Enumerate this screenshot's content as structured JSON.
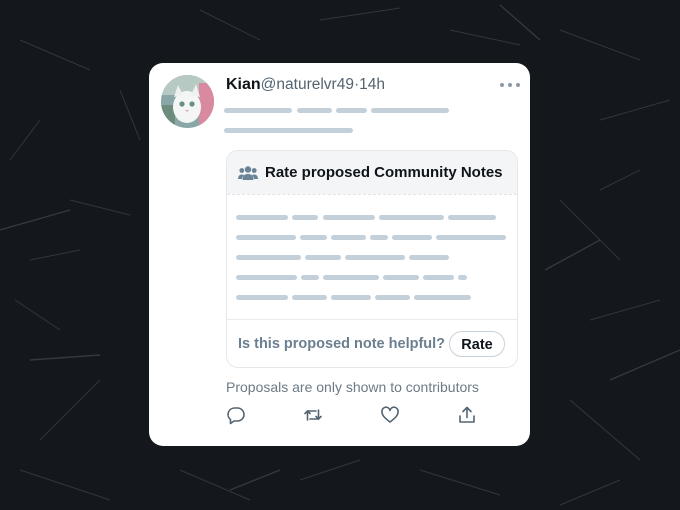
{
  "post": {
    "name": "Kian",
    "handle": "@naturelvr49",
    "separator": "·",
    "time": "14h",
    "more_icon": "more-horizontal-icon"
  },
  "note": {
    "title": "Rate proposed Community Notes",
    "title_icon": "people-icon",
    "question": "Is this proposed note helpful?",
    "rate_label": "Rate"
  },
  "disclaimer": "Proposals are only shown to contributors",
  "actions": [
    {
      "icon": "reply-icon"
    },
    {
      "icon": "repost-icon"
    },
    {
      "icon": "like-icon"
    },
    {
      "icon": "share-icon"
    }
  ],
  "colors": {
    "background": "#14171c",
    "card": "#ffffff",
    "placeholder_bar": "#c4d0d9",
    "note_header": "#f3f5f7",
    "question_text": "#6a7f90"
  }
}
